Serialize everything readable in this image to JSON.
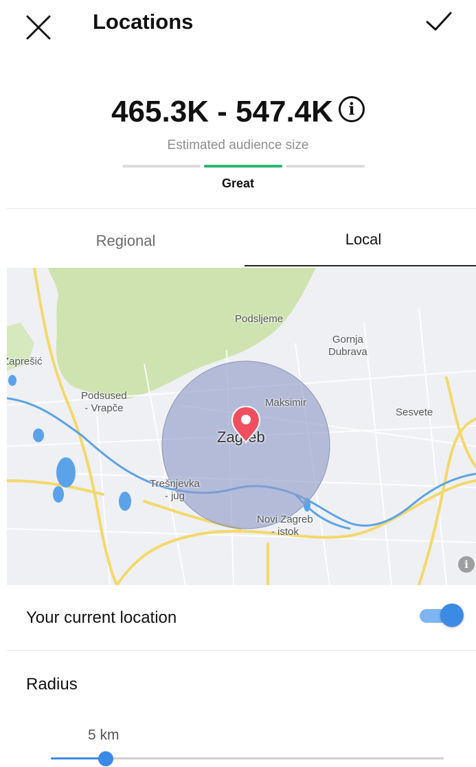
{
  "header": {
    "title": "Locations",
    "close_icon": "close-icon",
    "confirm_icon": "checkmark-icon"
  },
  "audience": {
    "range": "465.3K - 547.4K",
    "label": "Estimated audience size",
    "quality": "Great",
    "info_icon": "info-icon",
    "meter_active_segment": 2,
    "meter_segments": 3,
    "meter_active_color": "#2bb673"
  },
  "tabs": [
    {
      "label": "Regional",
      "selected": false
    },
    {
      "label": "Local",
      "selected": true
    }
  ],
  "map": {
    "labels": {
      "podsljeme": "Podsljeme",
      "gornja_dubrava": "Gornja\nDubrava",
      "zapresic": "Zaprešić",
      "podsused": "Podsused\n- Vrapče",
      "maksimir": "Maksimir",
      "sesvete": "Sesvete",
      "zagreb": "Zagreb",
      "tresnjevka": "Trešnjevka\n- jug",
      "novi_zagreb": "Novi Zagreb\n- istok"
    },
    "pin_icon": "map-pin-icon",
    "info_icon": "info-icon",
    "radius_circle_color": "#8f9bc7"
  },
  "current_location": {
    "label": "Your current location",
    "enabled": true
  },
  "radius": {
    "label": "Radius",
    "value_text": "5 km",
    "slider_fraction": 0.14
  },
  "colors": {
    "accent": "#3b8ae6",
    "success": "#2bb673"
  }
}
